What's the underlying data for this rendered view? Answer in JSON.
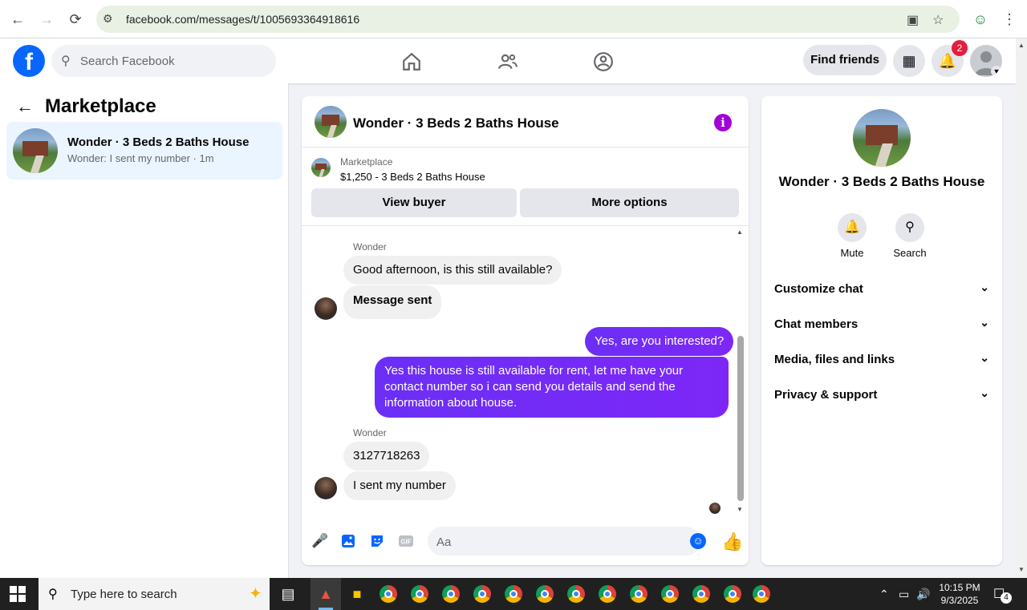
{
  "browser": {
    "url": "facebook.com/messages/t/1005693364918616"
  },
  "header": {
    "search_placeholder": "Search Facebook",
    "find_friends_label": "Find friends",
    "notification_count": "2"
  },
  "left_pane": {
    "title": "Marketplace",
    "conversation": {
      "name": "Wonder · 3 Beds 2 Baths House",
      "preview": "Wonder: I sent my number · 1m"
    }
  },
  "chat": {
    "title": "Wonder · 3 Beds 2 Baths House",
    "listing": {
      "source": "Marketplace",
      "price_title": "$1,250 - 3 Beds 2 Baths House",
      "view_buyer_label": "View buyer",
      "more_options_label": "More options"
    },
    "messages": [
      {
        "sender": "Wonder",
        "text": "Good afternoon, is this still available?"
      },
      {
        "text": "Message sent"
      },
      {
        "text": "Yes, are you interested?"
      },
      {
        "text": "Yes this house is still available for rent, let me have your contact number so i can send you details and send the information about house."
      },
      {
        "sender": "Wonder",
        "text": "3127718263"
      },
      {
        "text": "I sent my number"
      }
    ],
    "composer_placeholder": "Aa"
  },
  "info_panel": {
    "name": "Wonder · 3 Beds 2 Baths House",
    "mute_label": "Mute",
    "search_label": "Search",
    "sections": [
      "Customize chat",
      "Chat members",
      "Media, files and links",
      "Privacy & support"
    ]
  },
  "taskbar": {
    "search_placeholder": "Type here to search",
    "time": "10:15 PM",
    "date": "9/3/2025",
    "notification_count": "4"
  },
  "colors": {
    "brand_blue": "#0866ff",
    "outgoing_bubble": "#7027f6",
    "info_icon": "#a200d6",
    "badge_red": "#e41e3f"
  },
  "icons": [
    "back-arrow-icon",
    "forward-arrow-icon",
    "reload-icon",
    "home-icon",
    "friends-icon",
    "groups-icon",
    "menu-grid-icon",
    "bell-icon",
    "info-icon",
    "microphone-icon",
    "photo-icon",
    "sticker-icon",
    "gif-icon",
    "emoji-icon",
    "like-icon",
    "search-icon"
  ]
}
